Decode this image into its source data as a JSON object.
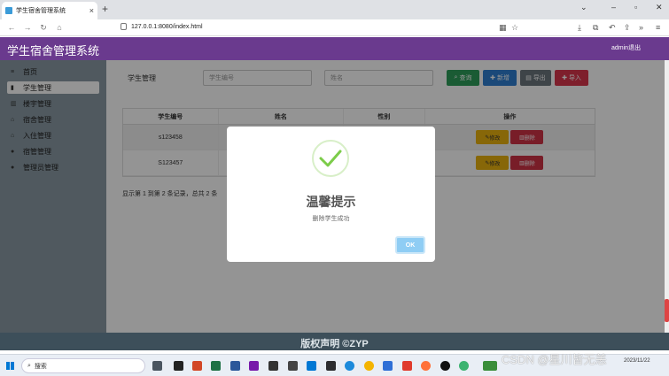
{
  "browser": {
    "tab_title": "学生宿舍管理系统",
    "url": "127.0.0.1:8080/index.html",
    "new_tab": "+",
    "close_tab": "×"
  },
  "app": {
    "title": "学生宿舍管理系统",
    "user": "admin退出"
  },
  "sidebar": {
    "items": [
      {
        "label": "首页",
        "icon": "≡"
      },
      {
        "label": "学生管理",
        "icon": "▮"
      },
      {
        "label": "楼宇管理",
        "icon": "▥"
      },
      {
        "label": "宿舍管理",
        "icon": "⌂"
      },
      {
        "label": "入住管理",
        "icon": "⌂"
      },
      {
        "label": "宿管管理",
        "icon": "●"
      },
      {
        "label": "管理员管理",
        "icon": "●"
      }
    ]
  },
  "search": {
    "label": "学生管理",
    "id_placeholder": "学生编号",
    "name_placeholder": "姓名",
    "query": "查询",
    "add": "新增",
    "export": "导出",
    "import": "导入"
  },
  "table": {
    "headers": [
      "学生编号",
      "姓名",
      "性别",
      "操作"
    ],
    "rows": [
      {
        "id": "s123458",
        "edit": "修改",
        "delete": "删除"
      },
      {
        "id": "S123457",
        "edit": "修改",
        "delete": "删除"
      }
    ],
    "pager": "显示第 1 到第 2 条记录，总共 2 条"
  },
  "modal": {
    "title": "温馨提示",
    "message": "删除学生成功",
    "ok": "OK"
  },
  "footer": {
    "text": "版权声明 ©ZYP"
  },
  "taskbar": {
    "search": "搜索",
    "time": "",
    "date": "2023/11/22"
  },
  "watermark": "CSDN @星川皆无恙",
  "colors": {
    "header": "#6a3a8e",
    "sidebar": "#8a9aa4",
    "query_btn": "#2e9e5b",
    "add_btn": "#2f7fd1",
    "export_btn": "#6c757d",
    "import_btn": "#d9364d",
    "edit_btn": "#e8b10f",
    "delete_btn": "#cf3246",
    "ok_btn": "#8fcdf4",
    "check": "#7ccc4a"
  }
}
